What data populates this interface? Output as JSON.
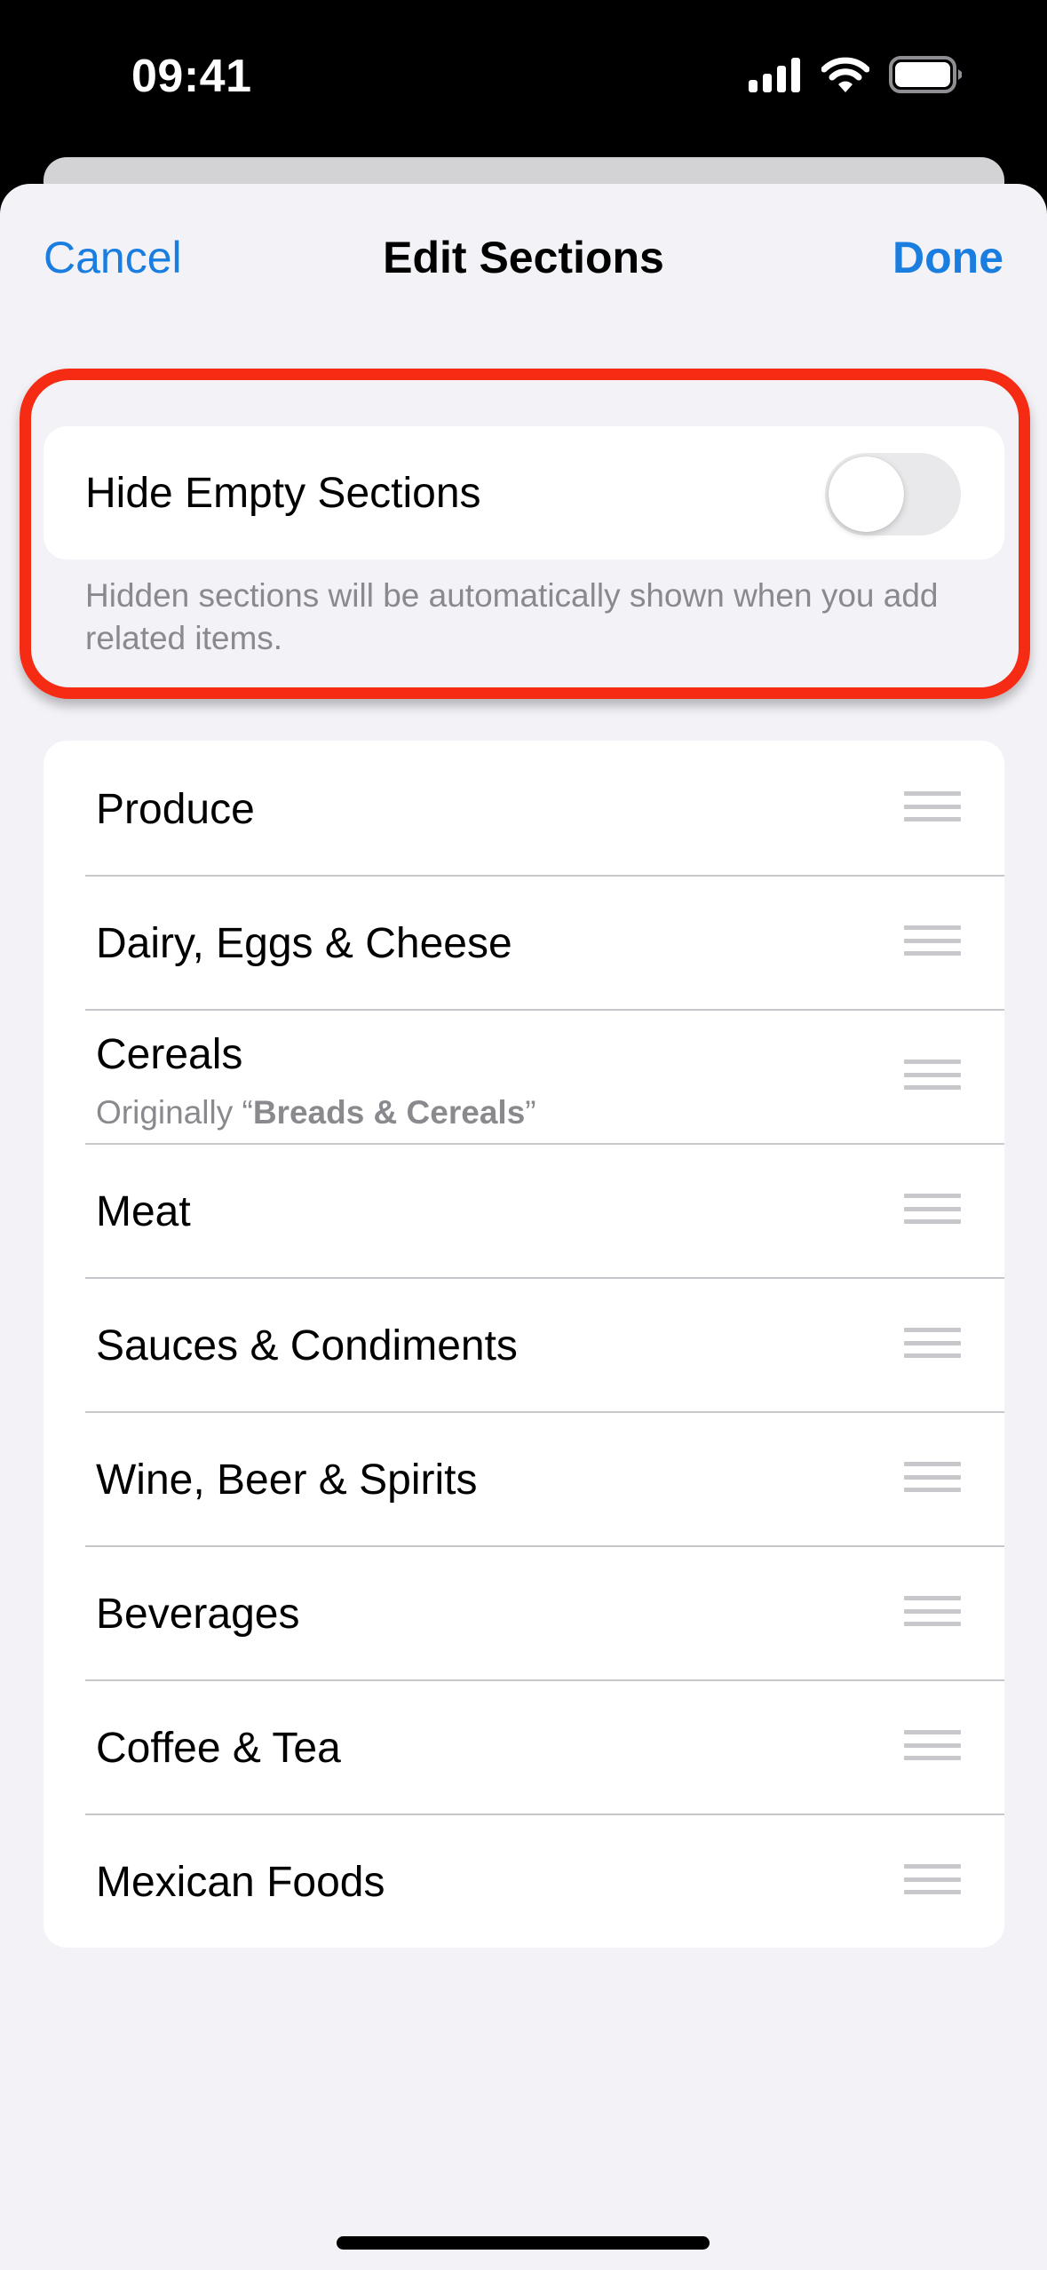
{
  "status_bar": {
    "time": "09:41",
    "icons": [
      "cellular-signal-icon",
      "wifi-icon",
      "battery-icon"
    ]
  },
  "nav": {
    "cancel_label": "Cancel",
    "title": "Edit Sections",
    "done_label": "Done"
  },
  "hide_empty": {
    "label": "Hide Empty Sections",
    "enabled": false,
    "footnote": "Hidden sections will be automatically shown when you add related items."
  },
  "colors": {
    "accent": "#1a7ee0",
    "highlight": "#f52b14",
    "background": "#f2f2f7"
  },
  "sections": [
    {
      "title": "Produce"
    },
    {
      "title": "Dairy, Eggs & Cheese"
    },
    {
      "title": "Cereals",
      "subtitle_prefix": "Originally “",
      "subtitle_bold": "Breads & Cereals",
      "subtitle_suffix": "”"
    },
    {
      "title": "Meat"
    },
    {
      "title": "Sauces & Condiments"
    },
    {
      "title": "Wine, Beer & Spirits"
    },
    {
      "title": "Beverages"
    },
    {
      "title": "Coffee & Tea"
    },
    {
      "title": "Mexican Foods"
    }
  ]
}
